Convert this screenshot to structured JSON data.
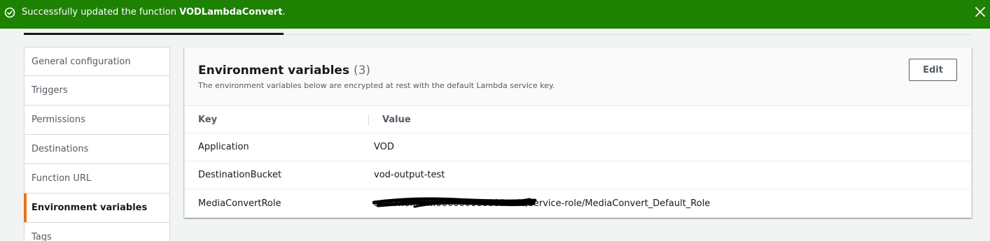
{
  "flash": {
    "message_prefix": "Successfully updated the function",
    "function_name": "VODLambdaConvert",
    "status_color": "#1d8102",
    "icons": {
      "status": "check-circle-icon",
      "dismiss": "close-icon"
    }
  },
  "sidenav": {
    "items": [
      {
        "label": "General configuration",
        "active": false
      },
      {
        "label": "Triggers",
        "active": false
      },
      {
        "label": "Permissions",
        "active": false
      },
      {
        "label": "Destinations",
        "active": false
      },
      {
        "label": "Function URL",
        "active": false
      },
      {
        "label": "Environment variables",
        "active": true
      },
      {
        "label": "Tags",
        "active": false
      }
    ],
    "active_accent_color": "#ec7211"
  },
  "env_panel": {
    "title": "Environment variables",
    "count": "(3)",
    "description": "The environment variables below are encrypted at rest with the default Lambda service key.",
    "edit_label": "Edit",
    "columns": {
      "key": "Key",
      "value": "Value"
    },
    "rows": [
      {
        "key": "Application",
        "value": "VOD"
      },
      {
        "key": "DestinationBucket",
        "value": "vod-output-test"
      },
      {
        "key": "MediaConvertRole",
        "value": "arn:aws:iam::000000000000:role/service-role/MediaConvert_Default_Role",
        "redacted": true
      }
    ]
  }
}
